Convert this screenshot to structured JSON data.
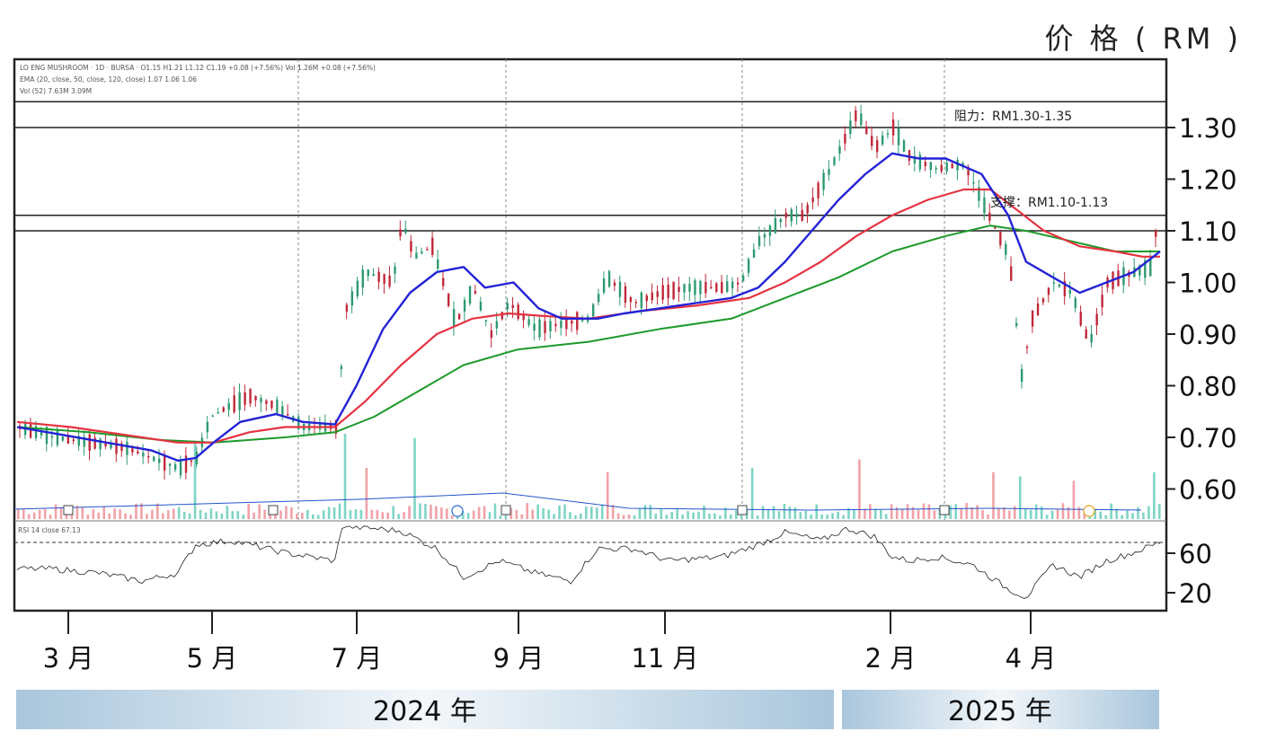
{
  "header": {
    "unit_label": "价 格 ( RM )",
    "indicator_line1": "LO ENG MUSHROOM · 1D · BURSA · O1.15 H1.21 L1.12 C1.19 +0.08 (+7.56%) Vol 1.26M +0.08 (+7.56%)",
    "indicator_line2": "EMA (20, close, 50, close, 120, close)  1.07  1.06  1.06",
    "indicator_line3": "Vol (52)  7.63M  3.09M"
  },
  "annotations": {
    "resistance": "阻力：RM1.30-1.35",
    "support": "支撑：RM1.10-1.13"
  },
  "rsi": {
    "label": "RSI 14 close 67.13",
    "ticks": [
      "60",
      "20"
    ]
  },
  "chart_data": {
    "type": "candlestick",
    "ylabel": "价 格 ( RM )",
    "ylim": [
      0.54,
      1.42
    ],
    "yticks": [
      "1.30",
      "1.20",
      "1.10",
      "1.00",
      "0.90",
      "0.80",
      "0.70",
      "0.60"
    ],
    "x_month_labels": [
      "3 月",
      "5 月",
      "7 月",
      "9 月",
      "11 月",
      "2 月",
      "4 月"
    ],
    "year_labels": [
      "2024 年",
      "2025 年"
    ],
    "horizontal_levels": [
      1.35,
      1.3,
      1.13,
      1.1
    ],
    "ema20_points": [
      [
        0,
        0.72
      ],
      [
        25,
        0.705
      ],
      [
        50,
        0.69
      ],
      [
        75,
        0.675
      ],
      [
        90,
        0.655
      ],
      [
        100,
        0.66
      ],
      [
        110,
        0.69
      ],
      [
        125,
        0.73
      ],
      [
        145,
        0.745
      ],
      [
        160,
        0.73
      ],
      [
        178,
        0.725
      ],
      [
        190,
        0.8
      ],
      [
        205,
        0.91
      ],
      [
        220,
        0.98
      ],
      [
        235,
        1.02
      ],
      [
        250,
        1.03
      ],
      [
        262,
        0.99
      ],
      [
        278,
        1.0
      ],
      [
        292,
        0.95
      ],
      [
        305,
        0.93
      ],
      [
        325,
        0.93
      ],
      [
        340,
        0.94
      ],
      [
        360,
        0.95
      ],
      [
        380,
        0.96
      ],
      [
        400,
        0.97
      ],
      [
        415,
        0.99
      ],
      [
        430,
        1.04
      ],
      [
        445,
        1.1
      ],
      [
        460,
        1.16
      ],
      [
        475,
        1.21
      ],
      [
        490,
        1.25
      ],
      [
        505,
        1.24
      ],
      [
        520,
        1.24
      ],
      [
        540,
        1.21
      ],
      [
        555,
        1.13
      ],
      [
        565,
        1.04
      ],
      [
        580,
        1.01
      ],
      [
        595,
        0.98
      ],
      [
        610,
        1.0
      ],
      [
        625,
        1.02
      ],
      [
        640,
        1.06
      ]
    ],
    "ema50_points": [
      [
        0,
        0.73
      ],
      [
        30,
        0.72
      ],
      [
        60,
        0.705
      ],
      [
        90,
        0.69
      ],
      [
        110,
        0.69
      ],
      [
        130,
        0.71
      ],
      [
        150,
        0.72
      ],
      [
        178,
        0.72
      ],
      [
        195,
        0.77
      ],
      [
        215,
        0.84
      ],
      [
        235,
        0.9
      ],
      [
        255,
        0.93
      ],
      [
        275,
        0.94
      ],
      [
        295,
        0.935
      ],
      [
        320,
        0.93
      ],
      [
        350,
        0.945
      ],
      [
        380,
        0.955
      ],
      [
        410,
        0.97
      ],
      [
        430,
        1.0
      ],
      [
        450,
        1.04
      ],
      [
        470,
        1.09
      ],
      [
        490,
        1.13
      ],
      [
        510,
        1.16
      ],
      [
        530,
        1.18
      ],
      [
        545,
        1.18
      ],
      [
        560,
        1.14
      ],
      [
        575,
        1.1
      ],
      [
        595,
        1.07
      ],
      [
        615,
        1.06
      ],
      [
        630,
        1.05
      ],
      [
        640,
        1.05
      ]
    ],
    "ema120_points": [
      [
        0,
        0.72
      ],
      [
        40,
        0.71
      ],
      [
        80,
        0.695
      ],
      [
        110,
        0.69
      ],
      [
        150,
        0.7
      ],
      [
        178,
        0.71
      ],
      [
        200,
        0.74
      ],
      [
        225,
        0.79
      ],
      [
        250,
        0.84
      ],
      [
        280,
        0.87
      ],
      [
        320,
        0.885
      ],
      [
        360,
        0.91
      ],
      [
        400,
        0.93
      ],
      [
        430,
        0.97
      ],
      [
        460,
        1.01
      ],
      [
        490,
        1.06
      ],
      [
        520,
        1.09
      ],
      [
        545,
        1.11
      ],
      [
        565,
        1.1
      ],
      [
        590,
        1.08
      ],
      [
        615,
        1.06
      ],
      [
        640,
        1.06
      ]
    ],
    "price_path_points": [
      [
        0,
        0.72
      ],
      [
        20,
        0.7
      ],
      [
        40,
        0.69
      ],
      [
        60,
        0.68
      ],
      [
        75,
        0.66
      ],
      [
        90,
        0.64
      ],
      [
        100,
        0.66
      ],
      [
        108,
        0.74
      ],
      [
        118,
        0.76
      ],
      [
        130,
        0.78
      ],
      [
        145,
        0.76
      ],
      [
        160,
        0.72
      ],
      [
        178,
        0.72
      ],
      [
        184,
        0.95
      ],
      [
        195,
        1.02
      ],
      [
        210,
        1.0
      ],
      [
        215,
        1.12
      ],
      [
        222,
        1.05
      ],
      [
        232,
        1.07
      ],
      [
        245,
        0.92
      ],
      [
        255,
        0.99
      ],
      [
        265,
        0.9
      ],
      [
        275,
        0.96
      ],
      [
        290,
        0.91
      ],
      [
        305,
        0.92
      ],
      [
        320,
        0.93
      ],
      [
        330,
        1.01
      ],
      [
        345,
        0.96
      ],
      [
        360,
        0.98
      ],
      [
        375,
        0.99
      ],
      [
        395,
        0.99
      ],
      [
        405,
        1.0
      ],
      [
        415,
        1.08
      ],
      [
        430,
        1.13
      ],
      [
        440,
        1.13
      ],
      [
        455,
        1.22
      ],
      [
        470,
        1.33
      ],
      [
        480,
        1.26
      ],
      [
        490,
        1.3
      ],
      [
        500,
        1.24
      ],
      [
        515,
        1.22
      ],
      [
        530,
        1.23
      ],
      [
        545,
        1.12
      ],
      [
        555,
        1.05
      ],
      [
        562,
        0.82
      ],
      [
        568,
        0.93
      ],
      [
        580,
        1.0
      ],
      [
        590,
        0.98
      ],
      [
        600,
        0.88
      ],
      [
        610,
        1.0
      ],
      [
        625,
        1.02
      ],
      [
        635,
        1.03
      ],
      [
        640,
        1.19
      ]
    ],
    "rsi_points": [
      [
        0,
        0.45
      ],
      [
        20,
        0.45
      ],
      [
        45,
        0.4
      ],
      [
        70,
        0.3
      ],
      [
        90,
        0.4
      ],
      [
        100,
        0.75
      ],
      [
        120,
        0.8
      ],
      [
        150,
        0.65
      ],
      [
        178,
        0.55
      ],
      [
        182,
        0.98
      ],
      [
        200,
        0.95
      ],
      [
        215,
        0.92
      ],
      [
        235,
        0.7
      ],
      [
        250,
        0.35
      ],
      [
        270,
        0.55
      ],
      [
        290,
        0.4
      ],
      [
        310,
        0.3
      ],
      [
        325,
        0.7
      ],
      [
        345,
        0.7
      ],
      [
        365,
        0.55
      ],
      [
        395,
        0.6
      ],
      [
        415,
        0.75
      ],
      [
        430,
        0.9
      ],
      [
        450,
        0.8
      ],
      [
        465,
        0.95
      ],
      [
        480,
        0.85
      ],
      [
        490,
        0.6
      ],
      [
        500,
        0.55
      ],
      [
        515,
        0.6
      ],
      [
        535,
        0.5
      ],
      [
        555,
        0.2
      ],
      [
        565,
        0.1
      ],
      [
        580,
        0.5
      ],
      [
        595,
        0.35
      ],
      [
        610,
        0.55
      ],
      [
        625,
        0.65
      ],
      [
        640,
        0.78
      ]
    ],
    "volume_spikes": [
      [
        98,
        0.9
      ],
      [
        183,
        1.0
      ],
      [
        194,
        0.6
      ],
      [
        222,
        0.95
      ],
      [
        330,
        0.55
      ],
      [
        412,
        0.6
      ],
      [
        470,
        0.7
      ],
      [
        545,
        0.55
      ],
      [
        562,
        0.5
      ],
      [
        590,
        0.45
      ],
      [
        636,
        0.55
      ]
    ],
    "colors": {
      "ema20": "#2323d6",
      "ema50": "#e53340",
      "ema120": "#1c9a2a",
      "candle_up": "#2e9a70",
      "candle_down": "#c0283a",
      "vol_up": "#7fd4c6",
      "vol_down": "#f1a2a8",
      "year_band": "#a9c6dc",
      "levels": "#222222"
    }
  }
}
